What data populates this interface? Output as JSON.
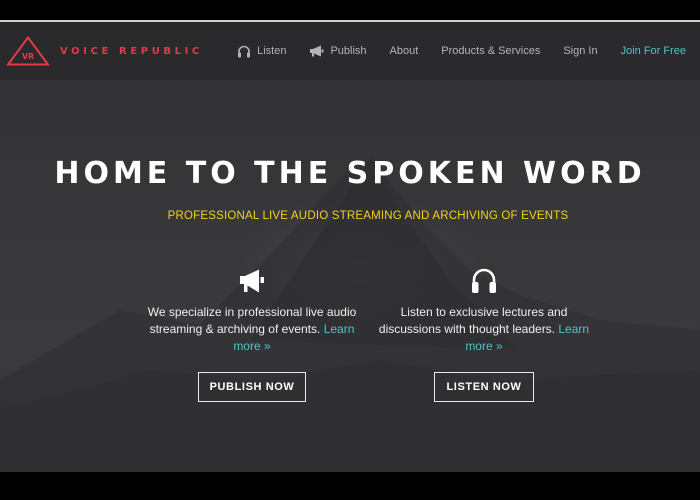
{
  "brand": {
    "logo_text": "VR",
    "name": "VOICE REPUBLIC",
    "accent": "#e23a4a"
  },
  "nav": {
    "listen": "Listen",
    "publish": "Publish",
    "about": "About",
    "products": "Products & Services",
    "signin": "Sign In",
    "join": "Join For Free",
    "join_color": "#4fc3c8"
  },
  "hero": {
    "title": "HOME TO THE SPOKEN WORD",
    "subtitle": "PROFESSIONAL LIVE AUDIO STREAMING AND ARCHIVING OF EVENTS",
    "subtitle_color": "#f2d21b"
  },
  "left": {
    "icon": "megaphone-icon",
    "text": "We specialize in professional live audio streaming & archiving of events.",
    "learn_more": "Learn more »",
    "button": "PUBLISH NOW"
  },
  "right": {
    "icon": "headphones-icon",
    "text": "Listen to exclusive lectures and discussions with thought leaders.",
    "learn_more": "Learn more »",
    "button": "LISTEN NOW"
  }
}
